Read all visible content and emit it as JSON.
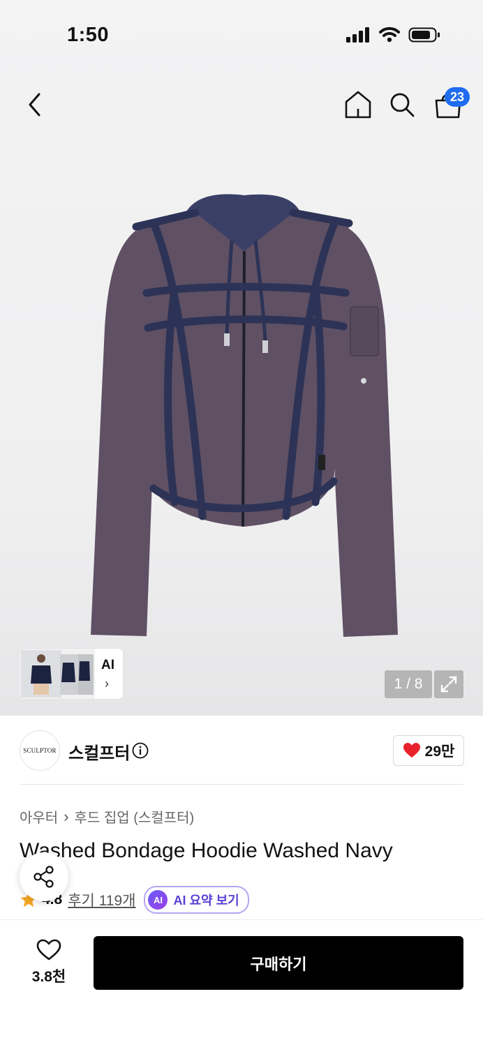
{
  "status_bar": {
    "time": "1:50"
  },
  "nav": {
    "cart_count": "23"
  },
  "gallery": {
    "ai_label": "AI",
    "pager": "1 / 8"
  },
  "brand": {
    "logo_text": "SCULPTOR",
    "name": "스컬프터",
    "likes": "29만"
  },
  "breadcrumb": {
    "category": "아우터",
    "subcategory": "후드 집업 (스컬프터)"
  },
  "product": {
    "title": "Washed Bondage Hoodie Washed Navy",
    "rating": "4.8",
    "reviews": "후기 119개",
    "ai_badge": "AI",
    "ai_summary": "AI 요약 보기"
  },
  "bottom": {
    "wish_count": "3.8천",
    "buy_label": "구매하기"
  },
  "colors": {
    "accent_blue": "#1f6cf0",
    "heart_red": "#e8212b",
    "star_orange": "#f5a623",
    "ai_purple": "#5b3fd9",
    "garment_purple": "#5f5064",
    "garment_navy": "#2c3356"
  }
}
